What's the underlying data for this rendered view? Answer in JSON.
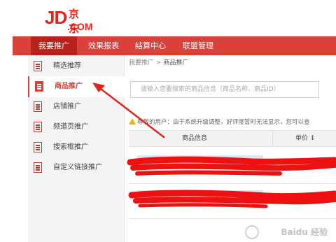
{
  "logo": {
    "jd": "JD",
    "cn": "京东",
    "com": ".COM"
  },
  "topnav": {
    "items": [
      {
        "label": "我要推广"
      },
      {
        "label": "效果报表"
      },
      {
        "label": "结算中心"
      },
      {
        "label": "联盟管理"
      }
    ]
  },
  "sidebar": {
    "items": [
      {
        "label": "精选推荐"
      },
      {
        "label": "商品推广"
      },
      {
        "label": "店铺推广"
      },
      {
        "label": "频道页推广"
      },
      {
        "label": "搜索框推广"
      },
      {
        "label": "自定义链接推广"
      }
    ]
  },
  "breadcrumb": {
    "parent": "我要推广",
    "sep": ">",
    "current": "商品推广"
  },
  "search": {
    "placeholder": "请输入您要搜索的商品信息（商品名称、商品ID）"
  },
  "notice": {
    "text": "尊敬的用户：由于系统升级调整，好评度暂时无法显示，您可以查"
  },
  "table": {
    "col_info": "商品信息",
    "col_price": "单价 ↕"
  },
  "watermark": {
    "text": "Baidu 经验"
  },
  "colors": {
    "brand_red": "#e1251b",
    "nav_red": "#d9413a",
    "scribble_red": "#ee1111"
  },
  "icons": {
    "sidebar": "document-icon",
    "notice": "warning-icon"
  }
}
